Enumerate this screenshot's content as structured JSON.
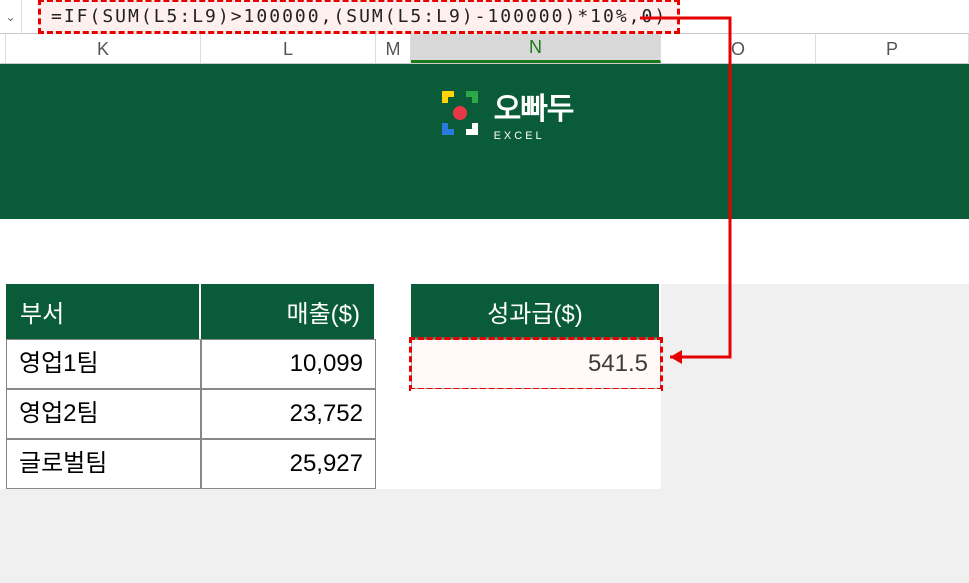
{
  "formula_bar": {
    "dropdown_glyph": "⌄",
    "formula": "=IF(SUM(L5:L9)>100000,(SUM(L5:L9)-100000)*10%,0)"
  },
  "columns": {
    "K": "K",
    "L": "L",
    "M": "M",
    "N": "N",
    "O": "O",
    "P": "P"
  },
  "logo": {
    "main": "오빠두",
    "sub": "EXCEL"
  },
  "table": {
    "headers": {
      "dept": "부서",
      "sales": "매출($)",
      "bonus": "성과급($)"
    },
    "rows": [
      {
        "dept": "영업1팀",
        "sales": "10,099",
        "bonus": "541.5"
      },
      {
        "dept": "영업2팀",
        "sales": "23,752",
        "bonus": ""
      },
      {
        "dept": "글로벌팀",
        "sales": "25,927",
        "bonus": ""
      }
    ]
  }
}
